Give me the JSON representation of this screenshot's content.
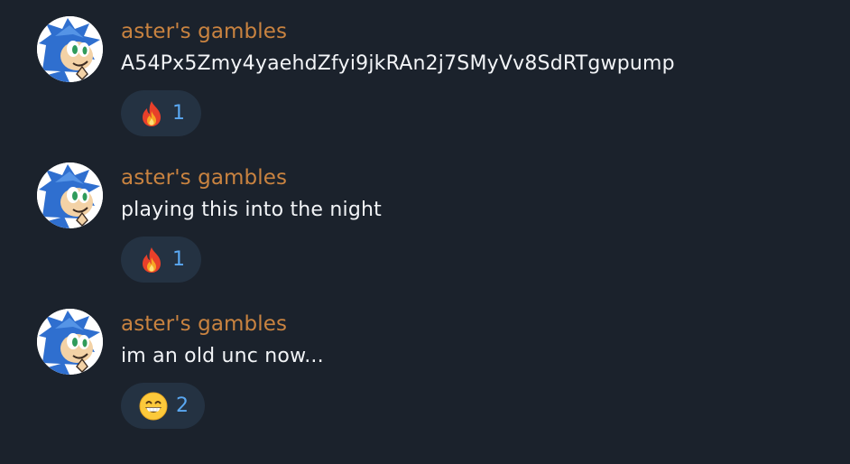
{
  "colors": {
    "background": "#1b222c",
    "author": "#c98340",
    "reaction_bg": "#243242",
    "reaction_count": "#5aa8f2"
  },
  "messages": [
    {
      "author": "aster's gambles",
      "text": "A54Px5Zmy4yaehdZfyi9jkRAn2j7SMyVv8SdRTgwpump",
      "reaction": {
        "icon": "fire-icon",
        "count": "1"
      }
    },
    {
      "author": "aster's gambles",
      "text": "playing this into the night",
      "reaction": {
        "icon": "fire-icon",
        "count": "1"
      }
    },
    {
      "author": "aster's gambles",
      "text": "im an old unc now...",
      "reaction": {
        "icon": "grinning-face-icon",
        "count": "2"
      }
    }
  ]
}
